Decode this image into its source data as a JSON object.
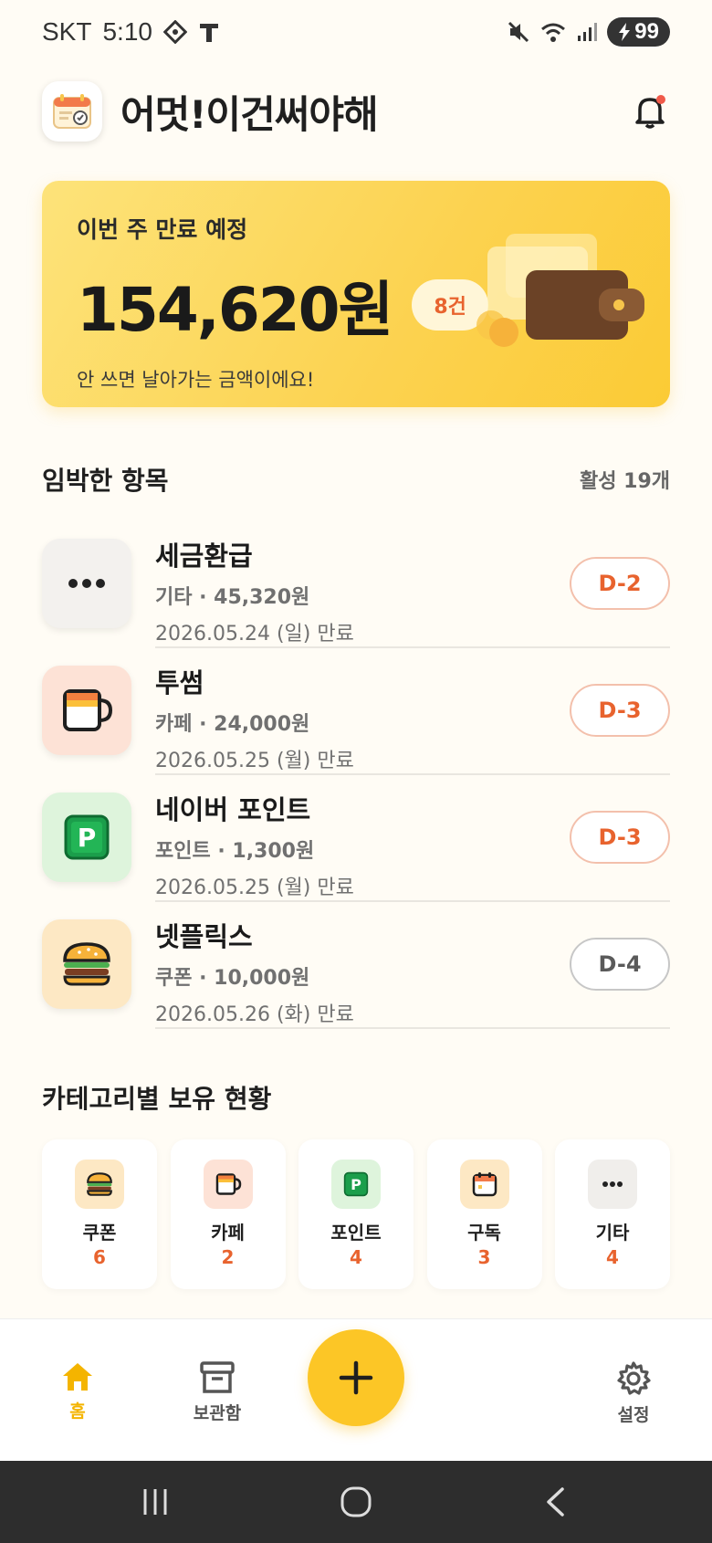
{
  "status_bar": {
    "carrier": "SKT",
    "time": "5:10",
    "battery": "99"
  },
  "header": {
    "title": "어멋!이건써야해"
  },
  "summary": {
    "label": "이번 주 만료 예정",
    "amount": "154,620원",
    "count": "8건",
    "note": "안 쓰면 날아가는 금액이에요!"
  },
  "upcoming": {
    "title": "임박한 항목",
    "meta": "활성 19개",
    "items": [
      {
        "name": "세금환급",
        "sub": "기타 · 45,320원",
        "date": "2026.05.24 (일) 만료",
        "dday": "D-2",
        "icon": "more-icon"
      },
      {
        "name": "투썸",
        "sub": "카페 · 24,000원",
        "date": "2026.05.25 (월) 만료",
        "dday": "D-3",
        "icon": "cup-icon"
      },
      {
        "name": "네이버 포인트",
        "sub": "포인트 · 1,300원",
        "date": "2026.05.25 (월) 만료",
        "dday": "D-3",
        "icon": "point-icon"
      },
      {
        "name": "넷플릭스",
        "sub": "쿠폰 · 10,000원",
        "date": "2026.05.26 (화) 만료",
        "dday": "D-4",
        "icon": "burger-icon"
      }
    ]
  },
  "categories": {
    "title": "카테고리별 보유 현황",
    "items": [
      {
        "label": "쿠폰",
        "count": "6"
      },
      {
        "label": "카페",
        "count": "2"
      },
      {
        "label": "포인트",
        "count": "4"
      },
      {
        "label": "구독",
        "count": "3"
      },
      {
        "label": "기타",
        "count": "4"
      }
    ]
  },
  "nav": {
    "home": "홈",
    "archive": "보관함",
    "settings": "설정"
  },
  "colors": {
    "accent": "#fcc626",
    "urgent": "#e8632e"
  }
}
